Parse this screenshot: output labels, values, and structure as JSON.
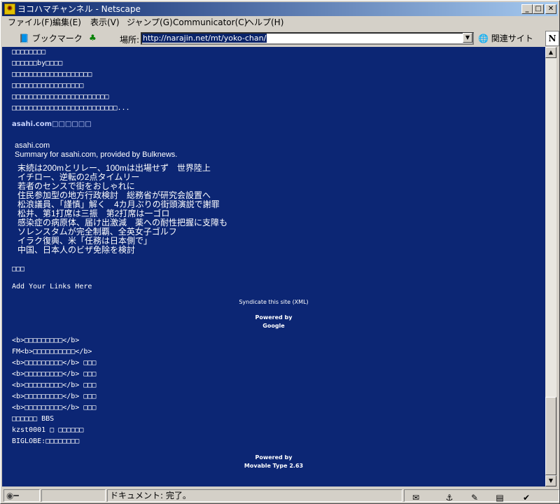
{
  "window": {
    "title": "ヨコハマチャンネル - Netscape",
    "controls": {
      "minimize": "_",
      "maximize": "□",
      "close": "✕"
    }
  },
  "menu": [
    "ファイル(F)",
    "編集(E)",
    "表示(V)",
    "ジャンプ(G)",
    "Communicator(C)",
    "ヘルプ(H)"
  ],
  "toolbar": {
    "bookmarks_label": "ブックマーク",
    "location_label": "場所:",
    "url": "http://narajin.net/mt/yoko-chan/",
    "related_label": "関連サイト"
  },
  "content": {
    "top_lines": [
      "□□□□□□□□",
      "□□□□□□by□□□□",
      "□□□□□□□□□□□□□□□□□□□",
      "□□□□□□□□□□□□□□□□□",
      "□□□□□□□□□□□□□□□□□□□□□□□",
      "□□□□□□□□□□□□□□□□□□□□□□□□□..."
    ],
    "asahi_heading": "asahi.com□□□□□□",
    "asahi_source": "asahi.com",
    "asahi_summary": "Summary for asahi.com, provided by Bulknews.",
    "news": [
      "末続は200mとリレー、100mは出場せず　世界陸上",
      "イチロー、逆転の2点タイムリー",
      "若者のセンスで街をおしゃれに",
      "住民参加型の地方行政検討　総務省が研究会設置へ",
      "松浪議員、「謹慎」解く　4カ月ぶりの街頭演説で謝罪",
      "松井、第1打席は三振　第2打席は一ゴロ",
      "感染症の病原体、届け出激減　薬への耐性把握に支障も",
      "ソレンスタムが完全制覇、全英女子ゴルフ",
      "イラク復興、米「任務は日本側で」",
      "中国、日本人のビザ免除を検討"
    ],
    "links_heading": "□□□",
    "add_links": "Add Your Links Here",
    "syndicate": "Syndicate this site (XML)",
    "powered_google_1": "Powered by",
    "powered_google_2": "Google",
    "bottom_lines": [
      "<b>□□□□□□□□□</b>",
      "FM<b>□□□□□□□□□□</b>",
      "<b>□□□□□□□□□</b> □□□",
      "<b>□□□□□□□□□</b> □□□",
      "<b>□□□□□□□□□</b> □□□",
      "<b>□□□□□□□□□</b> □□□",
      "<b>□□□□□□□□□</b> □□□",
      "□□□□□□ BBS",
      "kzst0001 □ □□□□□□",
      "BIGLOBE:□□□□□□□□"
    ],
    "powered_mt_1": "Powered by",
    "powered_mt_2": "Movable Type 2.63"
  },
  "status": {
    "text": "ドキュメント: 完了。"
  }
}
